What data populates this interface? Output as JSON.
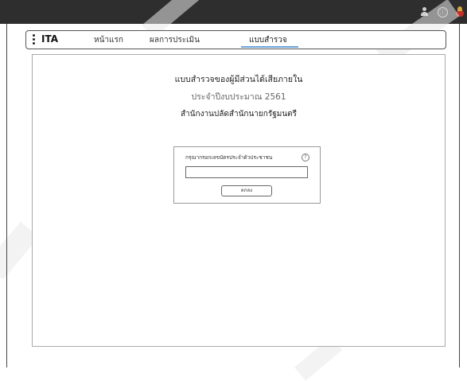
{
  "window": {
    "icons": [
      "user-icon",
      "info-icon",
      "seal-icon"
    ],
    "info_glyph": "ⓘ"
  },
  "nav": {
    "brand": "ITA",
    "items": [
      {
        "label": "หน้าแรก",
        "active": false
      },
      {
        "label": "ผลการประเมิน",
        "active": false
      },
      {
        "label": "แบบสำรวจ",
        "active": true
      }
    ],
    "accent_color": "#6aa3d8"
  },
  "content": {
    "title_line1": "แบบสำรวจของผู้มีส่วนได้เสียภายใน",
    "title_line2": "ประจำปีงบประมาณ 2561",
    "title_line3": "สำนักงานปลัดสำนักนายกรัฐมนตรี"
  },
  "form": {
    "label": "กรุณากรอกเลขบัตรประจำตัวประชาชน",
    "help_glyph": "?",
    "input_value": "",
    "submit_label": "ตกลง"
  }
}
